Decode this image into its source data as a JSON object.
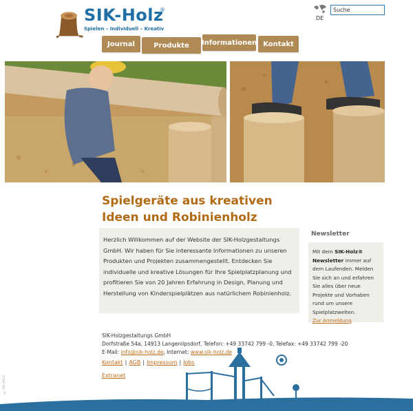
{
  "header": {
    "logo_title": "SIK-Holz",
    "logo_reg": "®",
    "logo_tagline": "Spielen – Individuell – Kreativ",
    "language": "DE",
    "search_value": "Suche"
  },
  "nav": {
    "tabs": [
      {
        "label": "Journal"
      },
      {
        "label": "Produkte"
      },
      {
        "label": "Informationen"
      },
      {
        "label": "Kontakt"
      }
    ]
  },
  "main": {
    "headline_line1": "Spielgeräte aus kreativen",
    "headline_line2": "Ideen und Robinienholz",
    "welcome_text": "Herzlich Willkommen auf der Website der SIK-Holzgestaltungs GmbH. Wir haben für Sie interessante Informationen zu unseren Produkten und Projekten zusammengestellt. Entdecken Sie individuelle und kreative Lösungen für Ihre Spielplatzplanung und profitieren Sie von 20 Jahren Erfahrung in Design, Planung und Herstellung von Kinderspielplätzen aus natürlichem Robinienholz."
  },
  "newsletter": {
    "heading": "Newsletter",
    "text_prefix": "Mit dem ",
    "brand": "SIK-Holz® Newsletter",
    "text_suffix": " immer auf dem Laufenden. Melden Sie sich an und erfahren Sie alles über neue Projekte und Vorhaben rund um unsere Spielplatzwelten.",
    "link": "Zur Anmeldung"
  },
  "address": {
    "company": "SIK-Holzgestaltungs GmbH",
    "street_line": "Dorfstraße 54a, 14913 Langenlipsdorf, Telefon: +49 33742 799 -0, Telefax: +49 33742 799 -20",
    "email_label": "E-Mail: ",
    "email": "info@sik-holz.de",
    "internet_label": ", Internet: ",
    "website": "www.sik-holz.de"
  },
  "footer": {
    "links": [
      "Kontakt",
      "AGB",
      "Impressum",
      "Jobs"
    ],
    "separator": "|",
    "extranet": "Extranet",
    "copyright": "© SIK-HOLZ"
  },
  "colors": {
    "brand_blue": "#1e6fa6",
    "nav_brown": "#b08a54",
    "headline_orange": "#b36a14",
    "box_bg": "#efeee8",
    "link_orange": "#c06a18"
  }
}
